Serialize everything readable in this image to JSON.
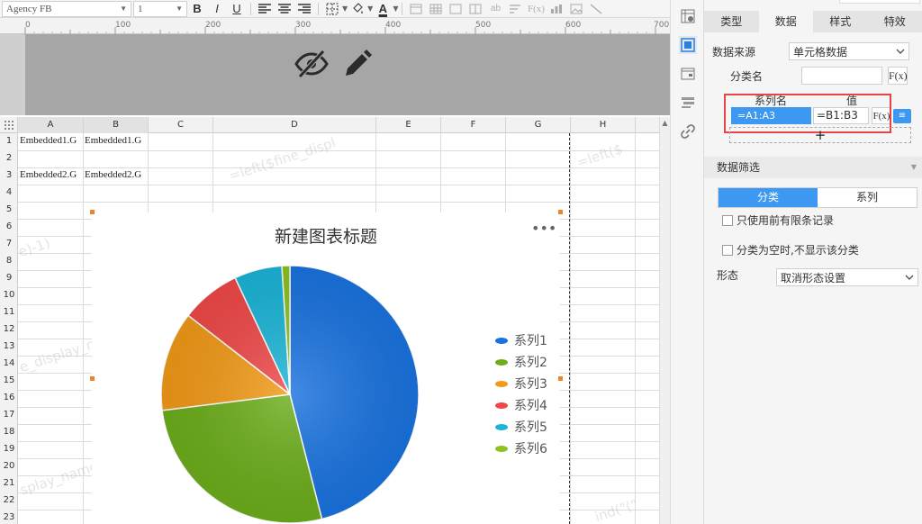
{
  "toolbar": {
    "font_family": "Agency FB",
    "font_size": "1",
    "bold": "B",
    "italic": "I",
    "underline": "U",
    "font_color_glyph": "A",
    "abc_glyph": "ab",
    "formula_glyph": "F(x)"
  },
  "ruler": {
    "ticks": [
      "0",
      "100",
      "200",
      "300",
      "400",
      "500",
      "600",
      "700"
    ]
  },
  "sheet": {
    "columns": [
      "A",
      "B",
      "C",
      "D",
      "E",
      "F",
      "G",
      "H"
    ],
    "rows": [
      "1",
      "2",
      "3",
      "4",
      "5",
      "6",
      "7",
      "8",
      "9",
      "10",
      "11",
      "12",
      "13",
      "14",
      "15",
      "16",
      "17",
      "18",
      "19",
      "20",
      "21",
      "22",
      "23"
    ],
    "cells": {
      "a1": "Embedded1.G",
      "b1": "Embedded1.G",
      "a3": "Embedded2.G",
      "b3": "Embedded2.G"
    },
    "watermark_fragments": [
      "=left($fine_displ",
      "=left($",
      "e)-1)",
      "splay_name,find(\"_\",$fine_display_name)",
      "fine_display_name,find(\"_\",$fine",
      "e_display_n",
      "=left($fine_display_name)-1)",
      "splay_name)-1)",
      "(\"_\",$fine_display_name)-1)",
      "ind(\"(\""
    ]
  },
  "chart": {
    "more": "•••"
  },
  "chart_data": {
    "type": "pie",
    "title": "新建图表标题",
    "legend": "right",
    "series": [
      {
        "name": "系列1",
        "value": 46,
        "color": "#1a73e0"
      },
      {
        "name": "系列2",
        "value": 27,
        "color": "#6cae1b"
      },
      {
        "name": "系列3",
        "value": 12.5,
        "color": "#f29a17"
      },
      {
        "name": "系列4",
        "value": 7.5,
        "color": "#f04848"
      },
      {
        "name": "系列5",
        "value": 6,
        "color": "#1bb5d8"
      },
      {
        "name": "系列6",
        "value": 1,
        "color": "#8dc21f"
      }
    ]
  },
  "panel": {
    "tabs": [
      {
        "label": "类型",
        "active": false
      },
      {
        "label": "数据",
        "active": true
      },
      {
        "label": "样式",
        "active": false
      },
      {
        "label": "特效",
        "active": false
      }
    ],
    "data_source_label": "数据来源",
    "data_source_value": "单元格数据",
    "category_name_label": "分类名",
    "category_name_value": "",
    "fx": "F(x)",
    "series_header_name": "系列名",
    "series_header_value": "值",
    "series_name_value": "=A1:A3",
    "series_value_value": "=B1:B3",
    "add": "+",
    "filter_section": "数据筛选",
    "seg_category": "分类",
    "seg_series": "系列",
    "only_use_limited": "只使用前有限条记录",
    "hide_empty_category": "分类为空时,不显示该分类",
    "shape_label": "形态",
    "shape_value": "取消形态设置"
  },
  "colors": {
    "accent": "#3d98f2",
    "highlight_border": "#e54545",
    "handle": "#e58a2b"
  }
}
